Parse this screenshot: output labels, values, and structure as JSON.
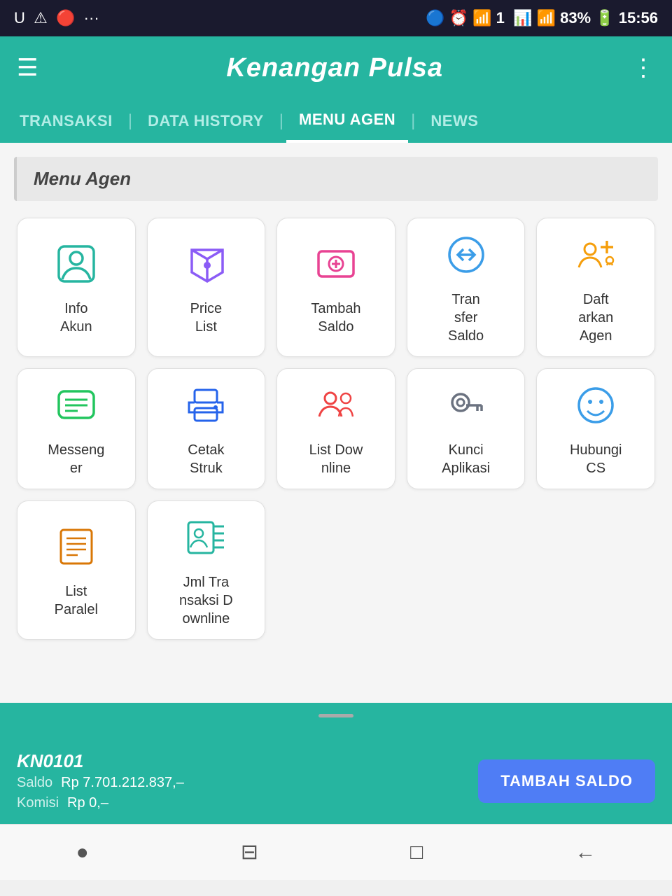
{
  "statusBar": {
    "leftIcons": "U ⚠ 🔴 ···",
    "rightIcons": "🔵 ⏰ 📶 1 📊 📶 83% 🔋 15:56"
  },
  "appBar": {
    "title": "Kenangan Pulsa",
    "hamburgerLabel": "☰",
    "moreLabel": "⋮"
  },
  "tabs": [
    {
      "id": "transaksi",
      "label": "TRANSAKSI",
      "active": false
    },
    {
      "id": "data-history",
      "label": "DATA HISTORY",
      "active": false
    },
    {
      "id": "menu-agen",
      "label": "MENU AGEN",
      "active": true
    },
    {
      "id": "news",
      "label": "NEWS",
      "active": false
    }
  ],
  "sectionHeader": "Menu Agen",
  "menuItems": [
    {
      "id": "info-akun",
      "label": "Info\nAkun",
      "iconColor": "icon-teal",
      "iconChar": "👤"
    },
    {
      "id": "price-list",
      "label": "Price\nList",
      "iconColor": "icon-purple",
      "iconChar": "🏷"
    },
    {
      "id": "tambah-saldo",
      "label": "Tambah\nSaldo",
      "iconColor": "icon-pink",
      "iconChar": "💳"
    },
    {
      "id": "transfer-saldo",
      "label": "Tran\nsfer\nSaldo",
      "iconColor": "icon-blue",
      "iconChar": "🔄"
    },
    {
      "id": "daftarkan-agen",
      "label": "Daft\narkan\nAgen",
      "iconColor": "icon-orange",
      "iconChar": "👥"
    },
    {
      "id": "messenger",
      "label": "Messeng\ner",
      "iconColor": "icon-green",
      "iconChar": "💬"
    },
    {
      "id": "cetak-struk",
      "label": "Cetak\nStruk",
      "iconColor": "icon-darkblue",
      "iconChar": "🖨"
    },
    {
      "id": "list-downline",
      "label": "List Dow\nnline",
      "iconColor": "icon-red",
      "iconChar": "👤"
    },
    {
      "id": "kunci-aplikasi",
      "label": "Kunci\nAplikasi",
      "iconColor": "icon-gray",
      "iconChar": "🔑"
    },
    {
      "id": "hubungi-cs",
      "label": "Hubungi\nCS",
      "iconColor": "icon-smile",
      "iconChar": "😊"
    },
    {
      "id": "list-paralel",
      "label": "List\nParalel",
      "iconColor": "icon-amber",
      "iconChar": "📋"
    },
    {
      "id": "jml-transaksi-downline",
      "label": "Jml Tra\nnsaksi D\nownline",
      "iconColor": "icon-teal",
      "iconChar": "👤"
    }
  ],
  "bottomBar": {
    "userId": "KN0101",
    "saldoLabel": "Saldo",
    "saldoValue": "Rp 7.701.212.837,–",
    "komisiLabel": "Komisi",
    "komisiValue": "Rp 0,–",
    "tambahSaldoBtn": "TAMBAH SALDO"
  },
  "navBar": {
    "homeIcon": "●",
    "recentIcon": "⊟",
    "squareIcon": "□",
    "backIcon": "←"
  }
}
